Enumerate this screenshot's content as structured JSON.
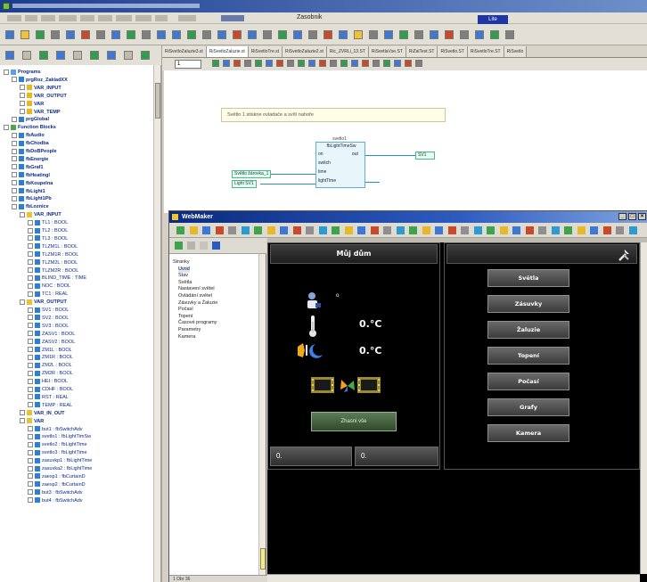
{
  "menu": {
    "filename": "Zasobnik",
    "badge": "Lite"
  },
  "file_tabs": [
    "RiSvetloZaluzie3.st",
    "RiSvetloZaluzie.st",
    "RiSvetloTre.st",
    "RiSvetloZaluzie2.st",
    "Ric_ZVRLi_13.ST",
    "RiSvetlaVse.ST",
    "RiZalTest.ST",
    "RiSvetlo.ST",
    "RiSvetloTre.ST",
    "RiSvetlo"
  ],
  "zoom": "1",
  "tree": [
    {
      "label": "Programs",
      "depth": 0,
      "icon": "blue2",
      "bold": true
    },
    {
      "label": "prgRoz_ZakladXX",
      "depth": 1,
      "icon": "blue",
      "bold": true
    },
    {
      "label": "VAR_INPUT",
      "depth": 2,
      "icon": "yellow",
      "bold": true
    },
    {
      "label": "VAR_OUTPUT",
      "depth": 2,
      "icon": "yellow",
      "bold": true
    },
    {
      "label": "VAR",
      "depth": 2,
      "icon": "yellow",
      "bold": true
    },
    {
      "label": "VAR_TEMP",
      "depth": 2,
      "icon": "yellow",
      "bold": true
    },
    {
      "label": "prgGlobal",
      "depth": 1,
      "icon": "blue",
      "bold": true
    },
    {
      "label": "Function Blocks",
      "depth": 0,
      "icon": "green",
      "bold": true
    },
    {
      "label": "fbAudio",
      "depth": 1,
      "icon": "blue",
      "bold": true
    },
    {
      "label": "fbChodba",
      "depth": 1,
      "icon": "blue",
      "bold": true
    },
    {
      "label": "fbDoBPeople",
      "depth": 1,
      "icon": "blue",
      "bold": true
    },
    {
      "label": "fbEnergie",
      "depth": 1,
      "icon": "blue",
      "bold": true
    },
    {
      "label": "fbGraf1",
      "depth": 1,
      "icon": "blue",
      "bold": true
    },
    {
      "label": "fbHeatingI",
      "depth": 1,
      "icon": "blue",
      "bold": true
    },
    {
      "label": "fbKoupelna",
      "depth": 1,
      "icon": "blue",
      "bold": true
    },
    {
      "label": "fbLight1",
      "depth": 1,
      "icon": "blue",
      "bold": true
    },
    {
      "label": "fbLight1Pb",
      "depth": 1,
      "icon": "blue",
      "bold": true
    },
    {
      "label": "fbLoznice",
      "depth": 1,
      "icon": "blue",
      "bold": true
    },
    {
      "label": "VAR_INPUT",
      "depth": 2,
      "icon": "folder",
      "bold": true
    },
    {
      "label": "TL1 : BOOL",
      "depth": 3,
      "icon": "blue",
      "bold": false
    },
    {
      "label": "TL2 : BOOL",
      "depth": 3,
      "icon": "blue",
      "bold": false
    },
    {
      "label": "TL3 : BOOL",
      "depth": 3,
      "icon": "blue",
      "bold": false
    },
    {
      "label": "TLZM1L : BOOL",
      "depth": 3,
      "icon": "blue",
      "bold": false
    },
    {
      "label": "TLZM1R : BOOL",
      "depth": 3,
      "icon": "blue",
      "bold": false
    },
    {
      "label": "TLZM2L : BOOL",
      "depth": 3,
      "icon": "blue",
      "bold": false
    },
    {
      "label": "TLZM2R : BOOL",
      "depth": 3,
      "icon": "blue",
      "bold": false
    },
    {
      "label": "BLIND_TIME : TIME",
      "depth": 3,
      "icon": "blue",
      "bold": false
    },
    {
      "label": "NOC : BOOL",
      "depth": 3,
      "icon": "blue",
      "bold": false
    },
    {
      "label": "TC1 : REAL",
      "depth": 3,
      "icon": "blue",
      "bold": false
    },
    {
      "label": "VAR_OUTPUT",
      "depth": 2,
      "icon": "folder",
      "bold": true
    },
    {
      "label": "SV1 : BOOL",
      "depth": 3,
      "icon": "blue",
      "bold": false
    },
    {
      "label": "SV2 : BOOL",
      "depth": 3,
      "icon": "blue",
      "bold": false
    },
    {
      "label": "SV3 : BOOL",
      "depth": 3,
      "icon": "blue",
      "bold": false
    },
    {
      "label": "ZASV1 : BOOL",
      "depth": 3,
      "icon": "blue",
      "bold": false
    },
    {
      "label": "ZASV2 : BOOL",
      "depth": 3,
      "icon": "blue",
      "bold": false
    },
    {
      "label": "ZM1L : BOOL",
      "depth": 3,
      "icon": "blue",
      "bold": false
    },
    {
      "label": "ZM1R : BOOL",
      "depth": 3,
      "icon": "blue",
      "bold": false
    },
    {
      "label": "ZM2L : BOOL",
      "depth": 3,
      "icon": "blue",
      "bold": false
    },
    {
      "label": "ZM2R : BOOL",
      "depth": 3,
      "icon": "blue",
      "bold": false
    },
    {
      "label": "HEI : BOOL",
      "depth": 3,
      "icon": "blue",
      "bold": false
    },
    {
      "label": "CDHF : BOOL",
      "depth": 3,
      "icon": "blue",
      "bold": false
    },
    {
      "label": "RST : REAL",
      "depth": 3,
      "icon": "blue",
      "bold": false
    },
    {
      "label": "TEMP : REAL",
      "depth": 3,
      "icon": "blue",
      "bold": false
    },
    {
      "label": "VAR_IN_OUT",
      "depth": 2,
      "icon": "folder",
      "bold": true
    },
    {
      "label": "VAR",
      "depth": 2,
      "icon": "folder",
      "bold": true
    },
    {
      "label": "but1 : fbSwitchAdv",
      "depth": 3,
      "icon": "blue",
      "bold": false
    },
    {
      "label": "svetlo1 : fbLightTimSw",
      "depth": 3,
      "icon": "blue",
      "bold": false
    },
    {
      "label": "svetlo2 : fbLightTime",
      "depth": 3,
      "icon": "blue",
      "bold": false
    },
    {
      "label": "svetlo3 : fbLightTime",
      "depth": 3,
      "icon": "blue",
      "bold": false
    },
    {
      "label": "zasuvkp1 : fbLightTime",
      "depth": 3,
      "icon": "blue",
      "bold": false
    },
    {
      "label": "zasuvka2 : fbLightTime",
      "depth": 3,
      "icon": "blue",
      "bold": false
    },
    {
      "label": "zaesp1 : fbCurtainD",
      "depth": 3,
      "icon": "blue",
      "bold": false
    },
    {
      "label": "zaesp2 : fbCurtainD",
      "depth": 3,
      "icon": "blue",
      "bold": false
    },
    {
      "label": "but3 : fbSwitchAdv",
      "depth": 3,
      "icon": "blue",
      "bold": false
    },
    {
      "label": "but4 : fbSwitchAdv",
      "depth": 3,
      "icon": "blue",
      "bold": false
    }
  ],
  "diagram": {
    "comment": "Světlo 1 stiskne ovladače a svítí nahoře",
    "fb_instance": "svetlo1",
    "fb_type": "fbLightTimeSw",
    "pins_in": [
      "on",
      "switch",
      "time",
      "lightTime"
    ],
    "pins_out": [
      "out"
    ],
    "in_var1": "Světlo žárovka_1",
    "in_var2": "Light SV1",
    "out_var": "SV1"
  },
  "webmaker": {
    "title": "WebMaker",
    "pages": [
      {
        "label": "Stranky",
        "depth": 0
      },
      {
        "label": "Uvod",
        "depth": 1
      },
      {
        "label": "Stav",
        "depth": 1
      },
      {
        "label": "Světla",
        "depth": 1
      },
      {
        "label": "Nastavení světel",
        "depth": 1
      },
      {
        "label": "Ovládání světel",
        "depth": 1
      },
      {
        "label": "Zásuvky a Žaluzie",
        "depth": 1
      },
      {
        "label": "Počasí",
        "depth": 1
      },
      {
        "label": "Topení",
        "depth": 1
      },
      {
        "label": "Časové programy",
        "depth": 1
      },
      {
        "label": "Parametry",
        "depth": 1
      },
      {
        "label": "Kamera",
        "depth": 1
      }
    ],
    "status": "1 Obr 36"
  },
  "hmi": {
    "title": "Můj dům",
    "person_value": "o",
    "temp1": "0.°C",
    "temp2": "0.°C",
    "zhasni": "Zhasni vše",
    "field1": "0.",
    "field2": "0.",
    "menu": [
      "Světla",
      "Zásuvky",
      "Žaluzie",
      "Topení",
      "Počasí",
      "Grafy",
      "Kamera"
    ]
  }
}
